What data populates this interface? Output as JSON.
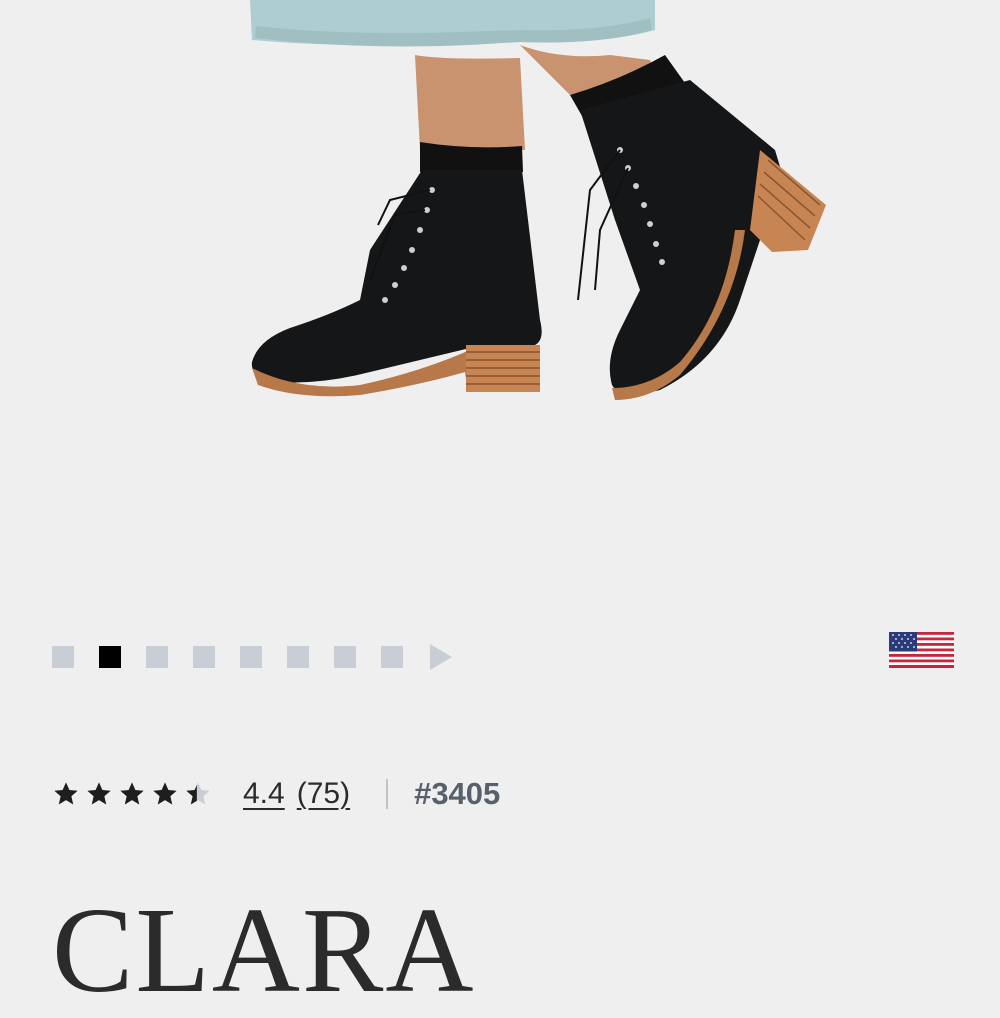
{
  "gallery": {
    "dot_count": 9,
    "active_index": 1
  },
  "region_flag": "us-flag-icon",
  "product": {
    "rating_value": "4.4",
    "rating_stars": 4.4,
    "review_count": "(75)",
    "style_number": "#3405",
    "name": "CLARA"
  },
  "colors": {
    "inactive_dot": "#c9ced6",
    "active_dot": "#000000",
    "text": "#2b2b2b",
    "style_number": "#57606b"
  }
}
